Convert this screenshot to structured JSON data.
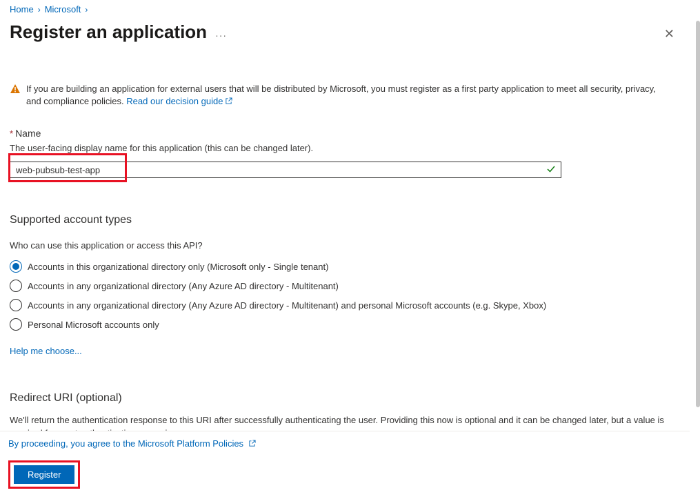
{
  "breadcrumb": {
    "home": "Home",
    "level1": "Microsoft"
  },
  "header": {
    "title": "Register an application"
  },
  "callout": {
    "text": "If you are building an application for external users that will be distributed by Microsoft, you must register as a first party application to meet all security, privacy, and compliance policies. ",
    "link": "Read our decision guide"
  },
  "nameField": {
    "label": "Name",
    "desc": "The user-facing display name for this application (this can be changed later).",
    "value": "web-pubsub-test-app"
  },
  "accountTypes": {
    "heading": "Supported account types",
    "question": "Who can use this application or access this API?",
    "options": [
      "Accounts in this organizational directory only (Microsoft only - Single tenant)",
      "Accounts in any organizational directory (Any Azure AD directory - Multitenant)",
      "Accounts in any organizational directory (Any Azure AD directory - Multitenant) and personal Microsoft accounts (e.g. Skype, Xbox)",
      "Personal Microsoft accounts only"
    ],
    "help": "Help me choose..."
  },
  "redirect": {
    "heading": "Redirect URI (optional)",
    "desc": "We'll return the authentication response to this URI after successfully authenticating the user. Providing this now is optional and it can be changed later, but a value is required for most authentication scenarios."
  },
  "footer": {
    "agree_prefix": "By proceeding, you agree to the ",
    "agree_link": "Microsoft Platform Policies",
    "register": "Register"
  }
}
